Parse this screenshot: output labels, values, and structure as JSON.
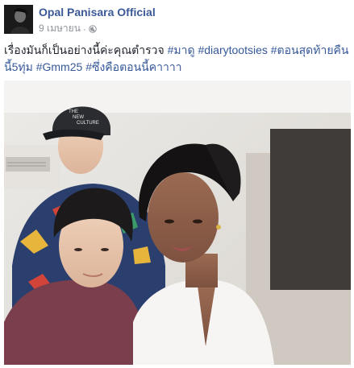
{
  "post": {
    "author": "Opal Panisara Official",
    "date": "9 เมษายน",
    "separator": "·",
    "privacy_icon": "globe-icon",
    "text_plain": "เรื่องมันก็เป็นอย่างนี้ค่ะคุณตำรวจ",
    "hashtags": [
      "#มาดู",
      "#diarytootsies",
      "#ตอนสุดท้ายคืนนี้5ทุ่ม",
      "#Gmm25",
      "#ซึ่งคือตอนนี้คาาาา"
    ],
    "cap_text_line1": "THE",
    "cap_text_line2": "NEW",
    "cap_text_line3": "CULTURE"
  },
  "colors": {
    "link": "#3b5998",
    "text": "#1d2129",
    "meta": "#90949c"
  }
}
